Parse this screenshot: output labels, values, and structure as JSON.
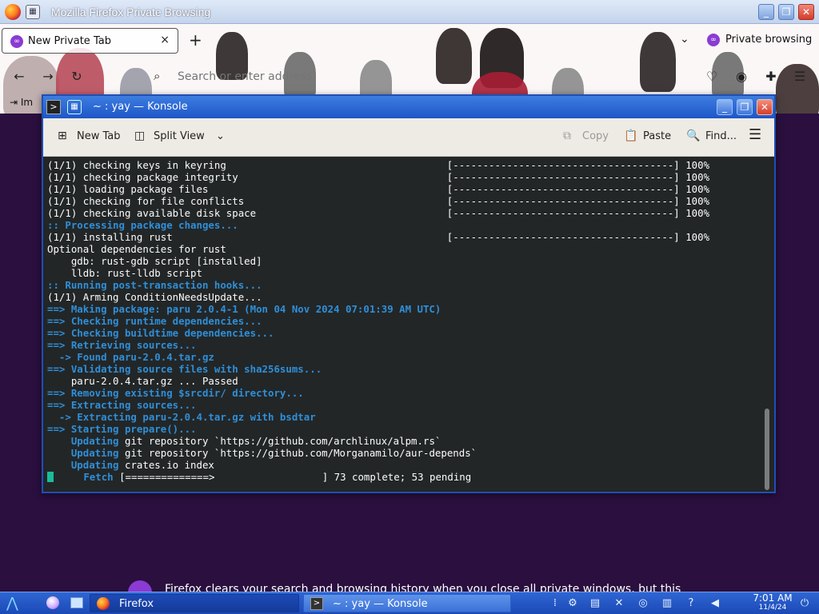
{
  "firefox": {
    "window_title": "Mozilla Firefox Private Browsing",
    "tab_label": "New Private Tab",
    "tab_close": "×",
    "new_tab": "+",
    "tab_list": "⌄",
    "private_indicator": "Private browsing",
    "url_placeholder": "Search or enter address",
    "import_label": "Im",
    "private_message": "Firefox clears your search and browsing history when you close all private windows, but this"
  },
  "konsole": {
    "window_title": "~ : yay — Konsole",
    "toolbar": {
      "new_tab": "New Tab",
      "split_view": "Split View",
      "copy": "Copy",
      "paste": "Paste",
      "find": "Find..."
    },
    "terminal_lines": [
      {
        "text": "(1/1) checking keys in keyring                                     [-------------------------------------] 100%",
        "style": "white"
      },
      {
        "text": "(1/1) checking package integrity                                   [-------------------------------------] 100%",
        "style": "white"
      },
      {
        "text": "(1/1) loading package files                                        [-------------------------------------] 100%",
        "style": "white"
      },
      {
        "text": "(1/1) checking for file conflicts                                  [-------------------------------------] 100%",
        "style": "white"
      },
      {
        "text": "(1/1) checking available disk space                                [-------------------------------------] 100%",
        "style": "white"
      },
      {
        "text": ":: Processing package changes...",
        "style": "blue"
      },
      {
        "text": "(1/1) installing rust                                              [-------------------------------------] 100%",
        "style": "white"
      },
      {
        "text": "Optional dependencies for rust",
        "style": "white"
      },
      {
        "text": "    gdb: rust-gdb script [installed]",
        "style": "white"
      },
      {
        "text": "    lldb: rust-lldb script",
        "style": "white"
      },
      {
        "text": ":: Running post-transaction hooks...",
        "style": "blue"
      },
      {
        "text": "(1/1) Arming ConditionNeedsUpdate...",
        "style": "white"
      },
      {
        "text": "==> Making package: paru 2.0.4-1 (Mon 04 Nov 2024 07:01:39 AM UTC)",
        "style": "blue"
      },
      {
        "text": "==> Checking runtime dependencies...",
        "style": "blue"
      },
      {
        "text": "==> Checking buildtime dependencies...",
        "style": "blue"
      },
      {
        "text": "==> Retrieving sources...",
        "style": "blue"
      },
      {
        "text": "  -> Found paru-2.0.4.tar.gz",
        "style": "blue"
      },
      {
        "text": "==> Validating source files with sha256sums...",
        "style": "blue"
      },
      {
        "text": "    paru-2.0.4.tar.gz ... Passed",
        "style": "white"
      },
      {
        "text": "==> Removing existing $srcdir/ directory...",
        "style": "blue"
      },
      {
        "text": "==> Extracting sources...",
        "style": "blue"
      },
      {
        "text": "  -> Extracting paru-2.0.4.tar.gz with bsdtar",
        "style": "blue"
      },
      {
        "text": "==> Starting prepare()...",
        "style": "blue"
      },
      {
        "text": "    Updating git repository `https://github.com/archlinux/alpm.rs`",
        "style": "mixed-update"
      },
      {
        "text": "    Updating git repository `https://github.com/Morganamilo/aur-depends`",
        "style": "mixed-update"
      },
      {
        "text": "    Updating crates.io index",
        "style": "mixed-update"
      },
      {
        "text": "      Fetch [==============>                  ] 73 complete; 53 pending",
        "style": "mixed-fetch"
      }
    ]
  },
  "taskbar": {
    "firefox_label": "Firefox",
    "konsole_label": "~ : yay — Konsole",
    "clock_time": "7:01 AM",
    "clock_date": "11/4/24"
  },
  "icons": [
    "firefox-icon",
    "grid-icon",
    "private-mask-icon",
    "back-icon",
    "forward-icon",
    "reload-icon",
    "search-icon",
    "pocket-icon",
    "account-icon",
    "extensions-icon",
    "new-tab-icon",
    "split-view-icon",
    "copy-icon",
    "paste-icon",
    "find-icon",
    "hamburger-menu-icon",
    "start-menu-icon",
    "volume-icon",
    "clock-icon"
  ],
  "colors": {
    "accent": "#1d56c8",
    "terminal_bg": "#232627",
    "terminal_blue": "#2e8fd8",
    "private_purple": "#8b3bd3"
  }
}
